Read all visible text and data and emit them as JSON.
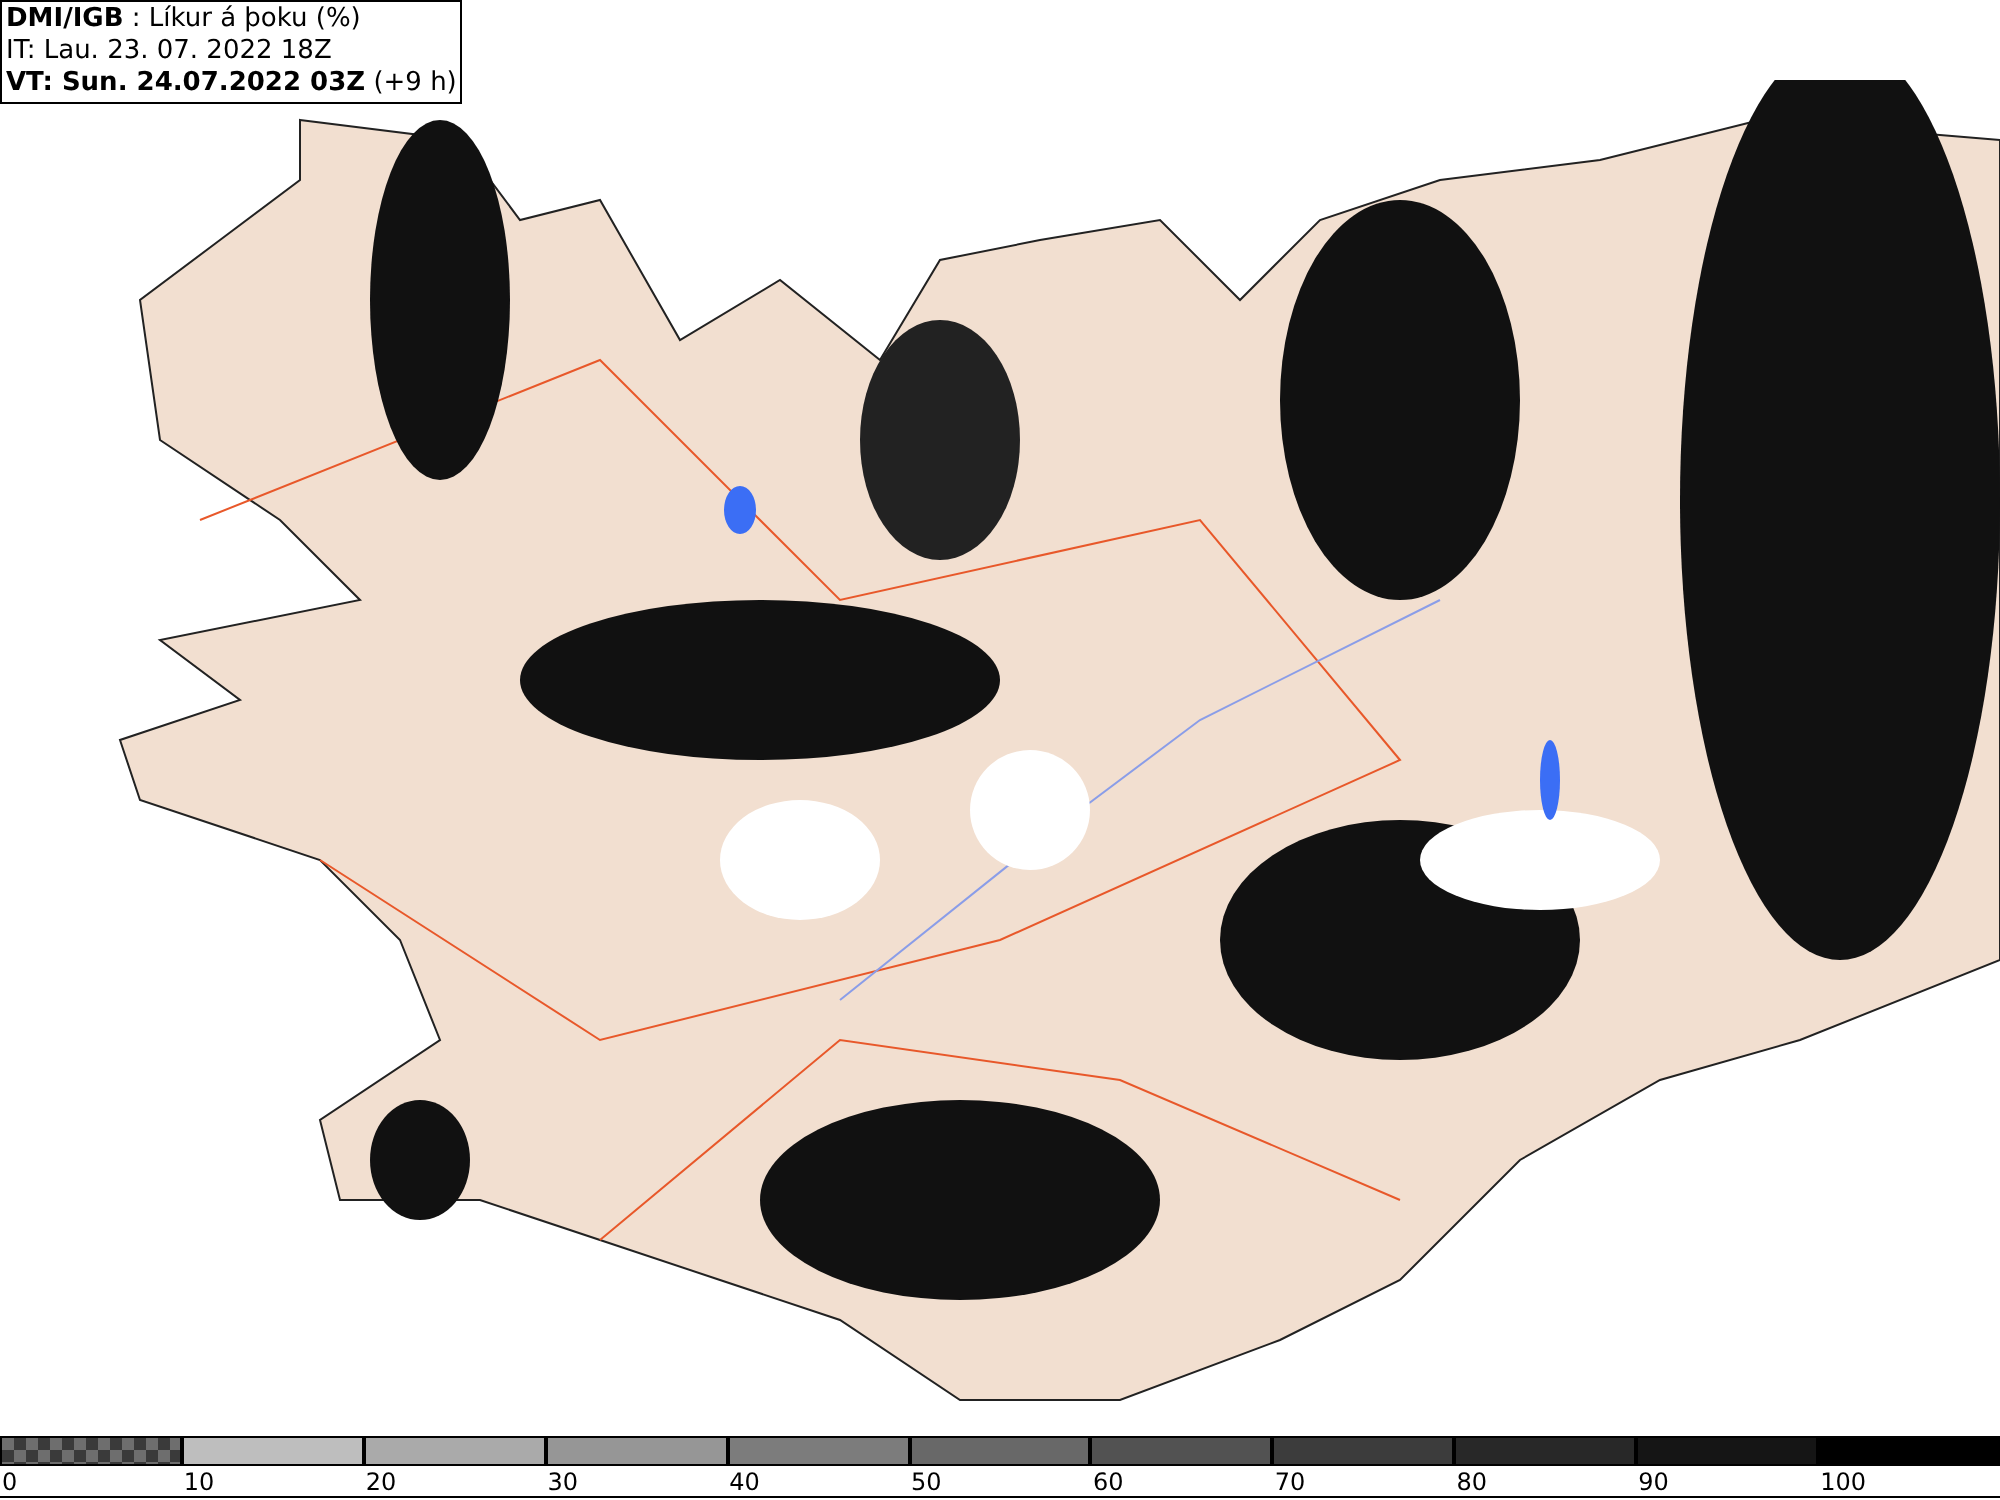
{
  "header": {
    "source": "DMI/IGB",
    "title": " : Líkur á þoku (%)",
    "issue_time": "IT: Lau. 23. 07. 2022 18Z",
    "valid_time": "VT: Sun. 24.07.2022 03Z",
    "offset": " (+9 h)"
  },
  "legend": [
    {
      "kind": "checker",
      "color": "#6e6e6e",
      "label": "0"
    },
    {
      "kind": "solid",
      "color": "#bebebe",
      "label": "10"
    },
    {
      "kind": "solid",
      "color": "#aaaaaa",
      "label": "20"
    },
    {
      "kind": "solid",
      "color": "#969696",
      "label": "30"
    },
    {
      "kind": "solid",
      "color": "#7c7c7c",
      "label": "40"
    },
    {
      "kind": "solid",
      "color": "#686868",
      "label": "50"
    },
    {
      "kind": "solid",
      "color": "#525252",
      "label": "60"
    },
    {
      "kind": "solid",
      "color": "#3c3c3c",
      "label": "70"
    },
    {
      "kind": "solid",
      "color": "#282828",
      "label": "80"
    },
    {
      "kind": "solid",
      "color": "#151515",
      "label": "90"
    },
    {
      "kind": "solid",
      "color": "#000000",
      "label": "100"
    }
  ]
}
